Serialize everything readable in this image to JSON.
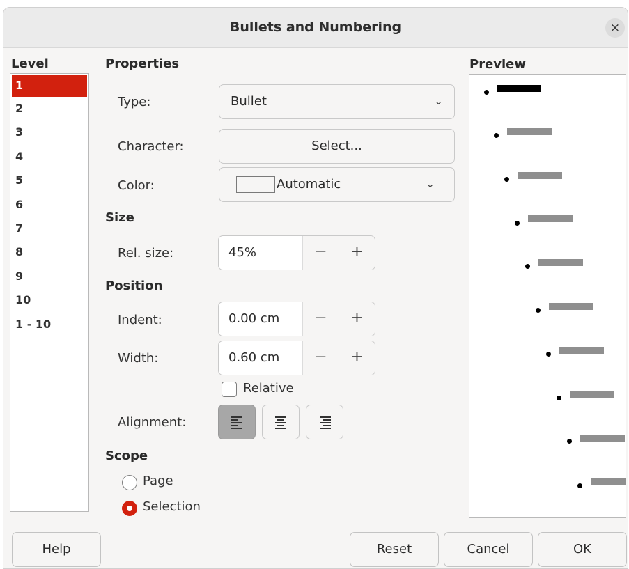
{
  "window": {
    "title": "Bullets and Numbering",
    "close_glyph": "×"
  },
  "level": {
    "heading": "Level",
    "items": [
      "1",
      "2",
      "3",
      "4",
      "5",
      "6",
      "7",
      "8",
      "9",
      "10",
      "1 - 10"
    ],
    "selected_index": 0
  },
  "properties": {
    "heading": "Properties",
    "type_label": "Type:",
    "type_value": "Bullet",
    "character_label": "Character:",
    "character_button": "Select...",
    "color_label": "Color:",
    "color_value": "Automatic"
  },
  "size": {
    "heading": "Size",
    "rel_size_label": "Rel. size:",
    "rel_size_value": "45%"
  },
  "position": {
    "heading": "Position",
    "indent_label": "Indent:",
    "indent_value": "0.00 cm",
    "width_label": "Width:",
    "width_value": "0.60 cm",
    "relative_label": "Relative",
    "relative_checked": false,
    "alignment_label": "Alignment:",
    "alignment_selected": "left"
  },
  "scope": {
    "heading": "Scope",
    "page_label": "Page",
    "selection_label": "Selection",
    "selected": "Selection"
  },
  "preview": {
    "heading": "Preview"
  },
  "spin_glyphs": {
    "minus": "−",
    "plus": "+"
  },
  "chevron_glyph": "⌄",
  "buttons": {
    "help": "Help",
    "reset": "Reset",
    "cancel": "Cancel",
    "ok": "OK"
  },
  "colors": {
    "accent": "#d2210e",
    "active_align": "#a7a7a7"
  }
}
